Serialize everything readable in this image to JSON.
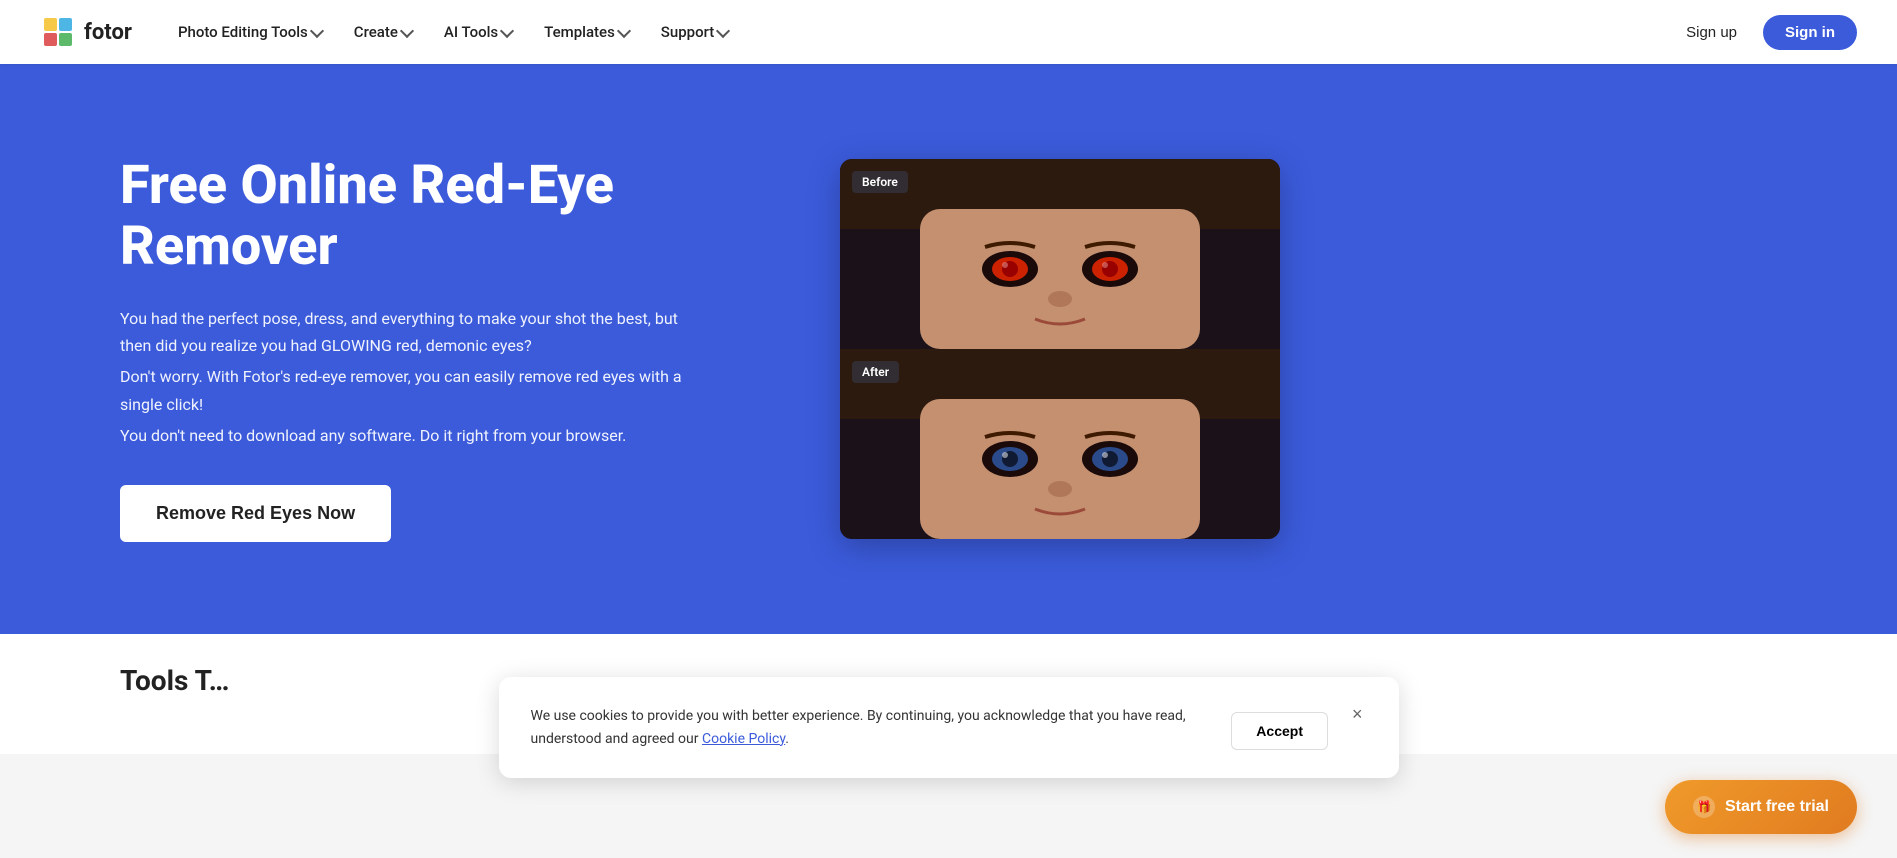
{
  "brand": {
    "name": "fotor"
  },
  "nav": {
    "items": [
      {
        "label": "Photo Editing Tools",
        "hasDropdown": true
      },
      {
        "label": "Create",
        "hasDropdown": true
      },
      {
        "label": "AI Tools",
        "hasDropdown": true
      },
      {
        "label": "Templates",
        "hasDropdown": true
      },
      {
        "label": "Support",
        "hasDropdown": true
      }
    ],
    "signup_label": "Sign up",
    "signin_label": "Sign in"
  },
  "hero": {
    "title": "Free Online Red-Eye Remover",
    "description_1": "You had the perfect pose, dress, and everything to make your shot the best, but then did you realize you had GLOWING red, demonic eyes?",
    "description_2": "Don't worry. With Fotor's red-eye remover, you can easily remove red eyes with a single click!",
    "description_3": "You don't need to download any software. Do it right from your browser.",
    "cta_label": "Remove Red Eyes Now",
    "before_label": "Before",
    "after_label": "After"
  },
  "cookie": {
    "message": "We use cookies to provide you with better experience. By continuing, you acknowledge that you have read, understood and agreed our",
    "link_text": "Cookie Policy",
    "link_suffix": ".",
    "accept_label": "Accept",
    "close_label": "×"
  },
  "trial": {
    "label": "Start free trial",
    "icon": "🎁"
  },
  "below": {
    "title": "Tools T..."
  },
  "colors": {
    "brand_blue": "#3b5bdb",
    "orange": "#e07b20",
    "white": "#ffffff"
  }
}
